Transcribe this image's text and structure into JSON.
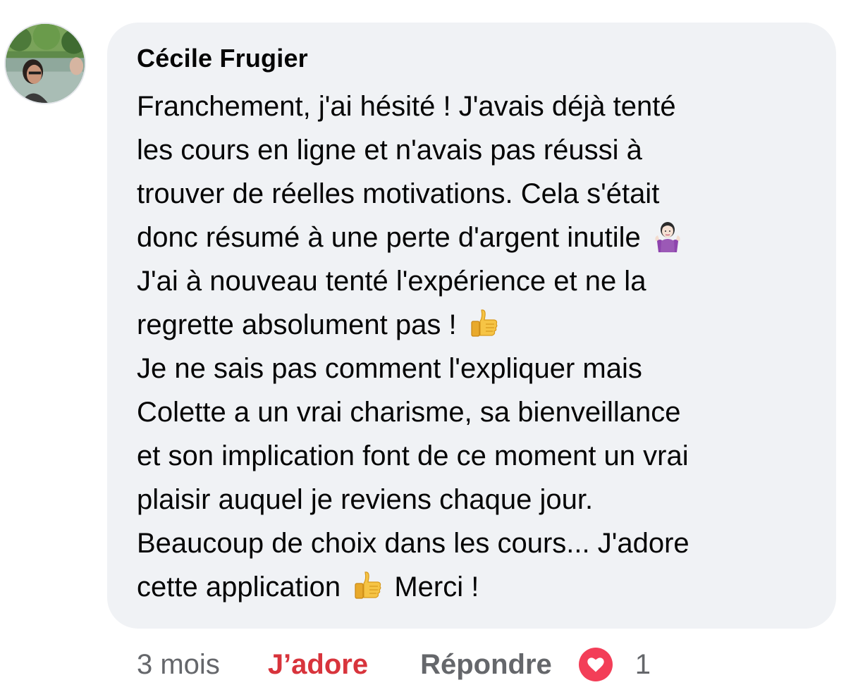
{
  "comment": {
    "author": "Cécile Frugier",
    "lines": [
      {
        "text": "Franchement, j'ai hésité !  J'avais déjà tenté",
        "emoji": null,
        "after": null
      },
      {
        "text": "les cours en ligne et  n'avais pas réussi à",
        "emoji": null,
        "after": null
      },
      {
        "text": "trouver de réelles motivations. Cela s'était",
        "emoji": null,
        "after": null
      },
      {
        "text": "donc résumé à une perte d'argent inutile ",
        "emoji": "woman-shrugging-emoji",
        "after": null
      },
      {
        "text": "J'ai à nouveau tenté l'expérience et ne la",
        "emoji": null,
        "after": null
      },
      {
        "text": "regrette absolument pas ! ",
        "emoji": "thumbs-up-emoji",
        "after": null
      },
      {
        "text": "Je ne sais pas comment l'expliquer mais",
        "emoji": null,
        "after": null
      },
      {
        "text": "Colette a un vrai charisme, sa bienveillance",
        "emoji": null,
        "after": null
      },
      {
        "text": "et son implication font de ce moment un vrai",
        "emoji": null,
        "after": null
      },
      {
        "text": "plaisir auquel je reviens chaque jour.",
        "emoji": null,
        "after": null
      },
      {
        "text": "Beaucoup de choix dans les cours... J'adore",
        "emoji": null,
        "after": null
      },
      {
        "text": "cette application ",
        "emoji": "thumbs-up-emoji",
        "after": " Merci !"
      }
    ]
  },
  "actions": {
    "time": "3 mois",
    "like_label": "J’adore",
    "reply_label": "Répondre",
    "reaction_icon": "heart-icon",
    "reaction_count": "1"
  },
  "colors": {
    "bubble": "#f0f2f5",
    "like_active": "#d8343c",
    "muted": "#65676b",
    "heart": "#f33e58"
  }
}
